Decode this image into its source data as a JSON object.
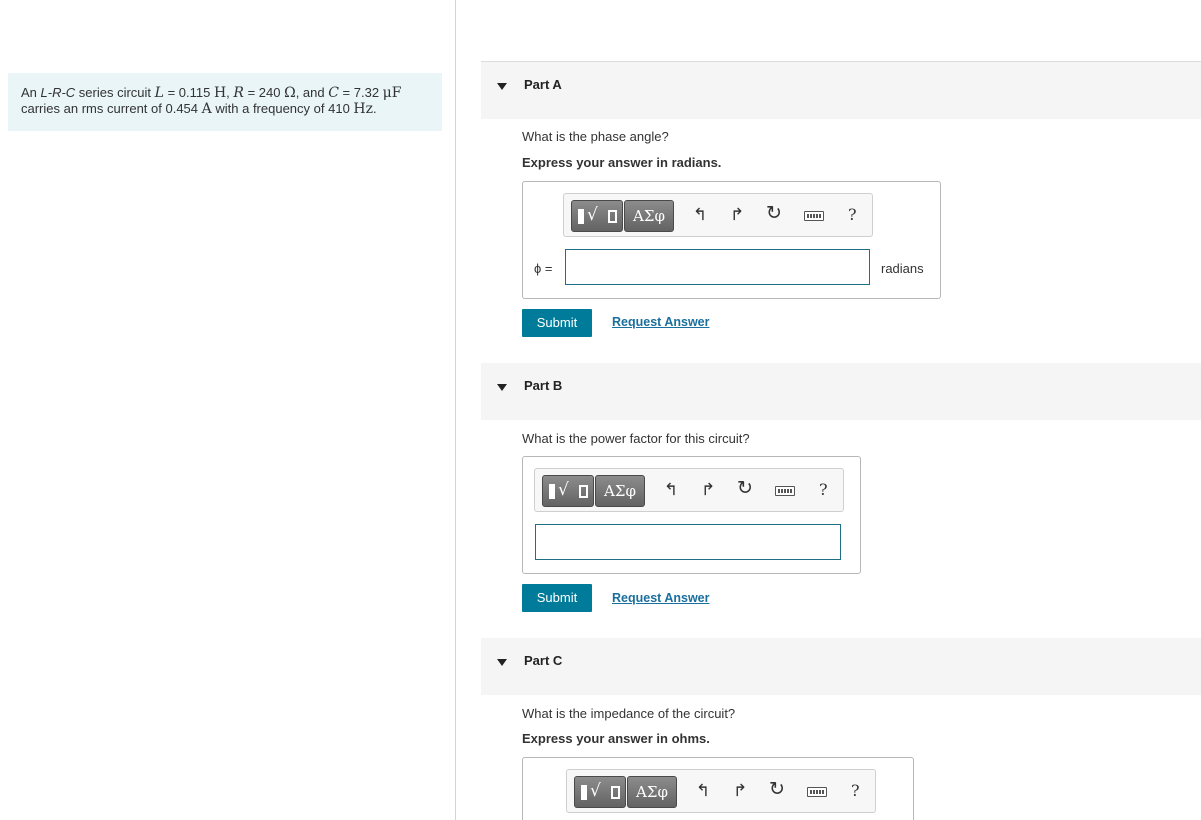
{
  "problem": {
    "p1": "An ",
    "circuit_type": "L-R-C",
    "p2": " series circuit ",
    "L_sym": "L",
    "eq1": " = 0.115 ",
    "L_unit": "H",
    "comma1": ", ",
    "R_sym": "R",
    "eq2": " = 240 ",
    "R_unit": "Ω",
    "p3": ", and ",
    "C_sym": "C",
    "eq3": " = 7.32 ",
    "C_unit": "μF",
    "line2a": "carries an rms current of 0.454 ",
    "I_unit": "A",
    "line2b": " with a frequency of 410 ",
    "f_unit": "Hz",
    "period": "."
  },
  "toolbar": {
    "templates_label": "√",
    "symbols_label": "ΑΣφ",
    "undo_glyph": "↰",
    "redo_glyph": "↱",
    "reset_glyph": "↻",
    "help_label": "?"
  },
  "parts": [
    {
      "title": "Part A",
      "question": "What is the phase angle?",
      "instruction": "Express your answer in radians.",
      "variable": "ϕ =",
      "unit": "radians",
      "submit": "Submit",
      "request": "Request Answer"
    },
    {
      "title": "Part B",
      "question": "What is the power factor for this circuit?",
      "submit": "Submit",
      "request": "Request Answer"
    },
    {
      "title": "Part C",
      "question": "What is the impedance of the circuit?",
      "instruction": "Express your answer in ohms."
    }
  ]
}
